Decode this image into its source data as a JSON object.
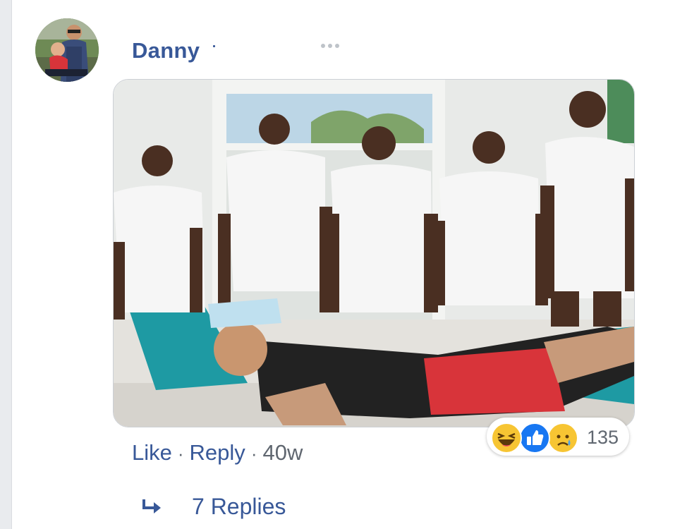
{
  "comment": {
    "author": "Danny",
    "media_description_icon": "photo",
    "actions": {
      "like": "Like",
      "reply": "Reply",
      "time": "40w",
      "separator": "·"
    },
    "reactions": {
      "icons": [
        "haha-icon",
        "like-icon",
        "sad-icon"
      ],
      "count": "135"
    },
    "replies_label": "7 Replies"
  },
  "colors": {
    "link": "#385898",
    "meta": "#606770",
    "like_blue": "#1877f2",
    "emoji_yellow": "#f7c533"
  }
}
